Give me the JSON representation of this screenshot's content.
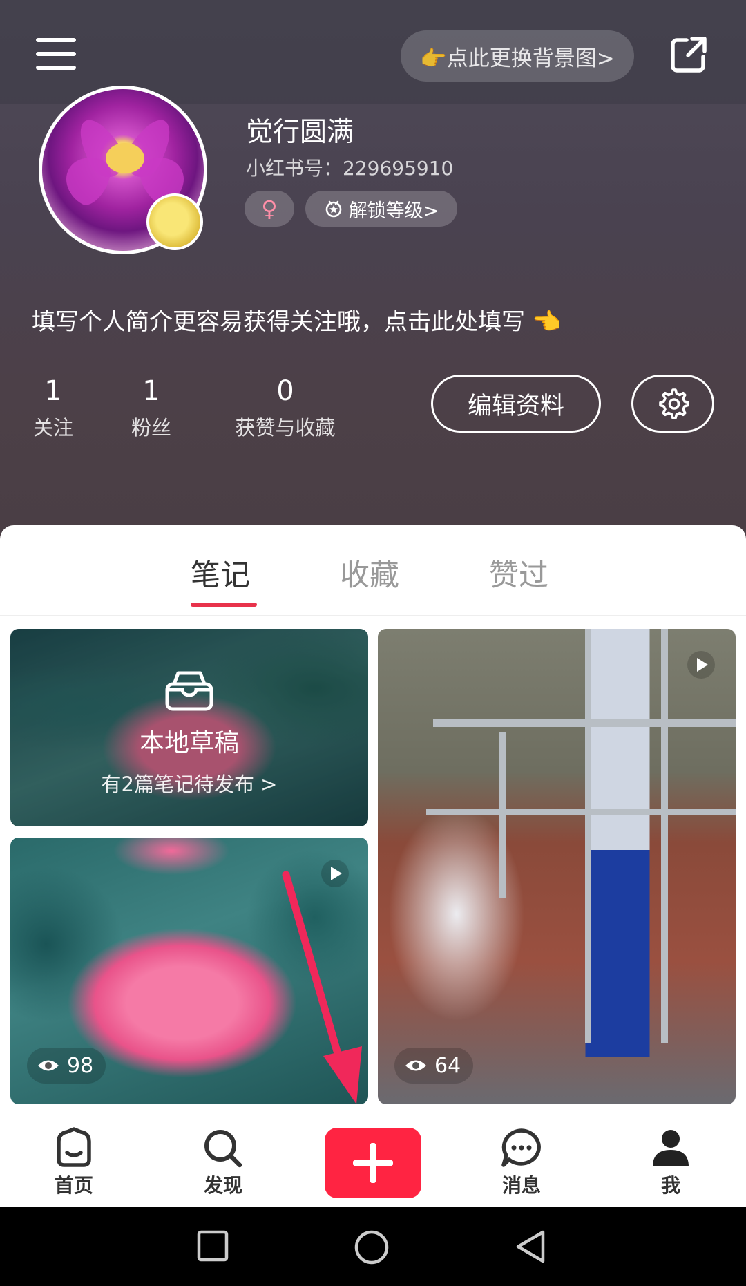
{
  "header": {
    "bg_button_label": "👉点此更换背景图>",
    "nickname": "觉行圆满",
    "user_id": "小红书号：229695910",
    "gender_symbol": "♀",
    "level_label": "解锁等级>",
    "bio": "填写个人简介更容易获得关注哦，点击此处填写",
    "bio_emoji": "👈",
    "stats": [
      {
        "value": "1",
        "label": "关注"
      },
      {
        "value": "1",
        "label": "粉丝"
      },
      {
        "value": "0",
        "label": "获赞与收藏"
      }
    ],
    "edit_label": "编辑资料"
  },
  "tabs": [
    {
      "label": "笔记"
    },
    {
      "label": "收藏"
    },
    {
      "label": "赞过"
    }
  ],
  "notes": {
    "drafts": {
      "title": "本地草稿",
      "subtitle": "有2篇笔记待发布 >"
    },
    "cards": [
      {
        "views": "98"
      },
      {
        "views": "64"
      }
    ]
  },
  "bottom_nav": [
    {
      "label": "首页"
    },
    {
      "label": "发现"
    },
    {
      "label": "消息"
    },
    {
      "label": "我"
    }
  ],
  "colors": {
    "accent": "#ff2442",
    "tab_underline": "#e8324b"
  }
}
